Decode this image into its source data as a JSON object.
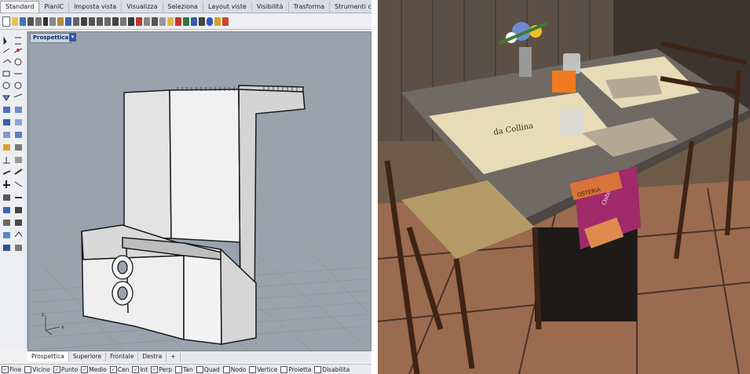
{
  "cad": {
    "menu_tabs": [
      "Standard",
      "PianiC",
      "Imposta vista",
      "Visualizza",
      "Seleziona",
      "Layout viste",
      "Visibilità",
      "Trasforma",
      "Strumenti cur"
    ],
    "viewport_title": "Prospettica",
    "viewport_dropdown_glyph": "▾",
    "view_tabs": [
      "Prospettica",
      "Superiore",
      "Frontale",
      "Destra"
    ],
    "add_view_glyph": "+",
    "osnaps": [
      {
        "label": "Fine",
        "checked": true
      },
      {
        "label": "Vicino",
        "checked": false
      },
      {
        "label": "Punto",
        "checked": true
      },
      {
        "label": "Medio",
        "checked": true
      },
      {
        "label": "Cen",
        "checked": true
      },
      {
        "label": "Int",
        "checked": true
      },
      {
        "label": "Perp",
        "checked": true
      },
      {
        "label": "Tan",
        "checked": false
      },
      {
        "label": "Quad",
        "checked": false
      },
      {
        "label": "Nodo",
        "checked": false
      },
      {
        "label": "Vertice",
        "checked": false
      },
      {
        "label": "Proietta",
        "checked": false
      },
      {
        "label": "Disabilita",
        "checked": false
      }
    ],
    "axis_labels": {
      "z": "z",
      "x": "x"
    }
  },
  "photo": {
    "placemat_text": "da Collina",
    "card_text": "Osteria",
    "block_text": "OSTERIA"
  }
}
